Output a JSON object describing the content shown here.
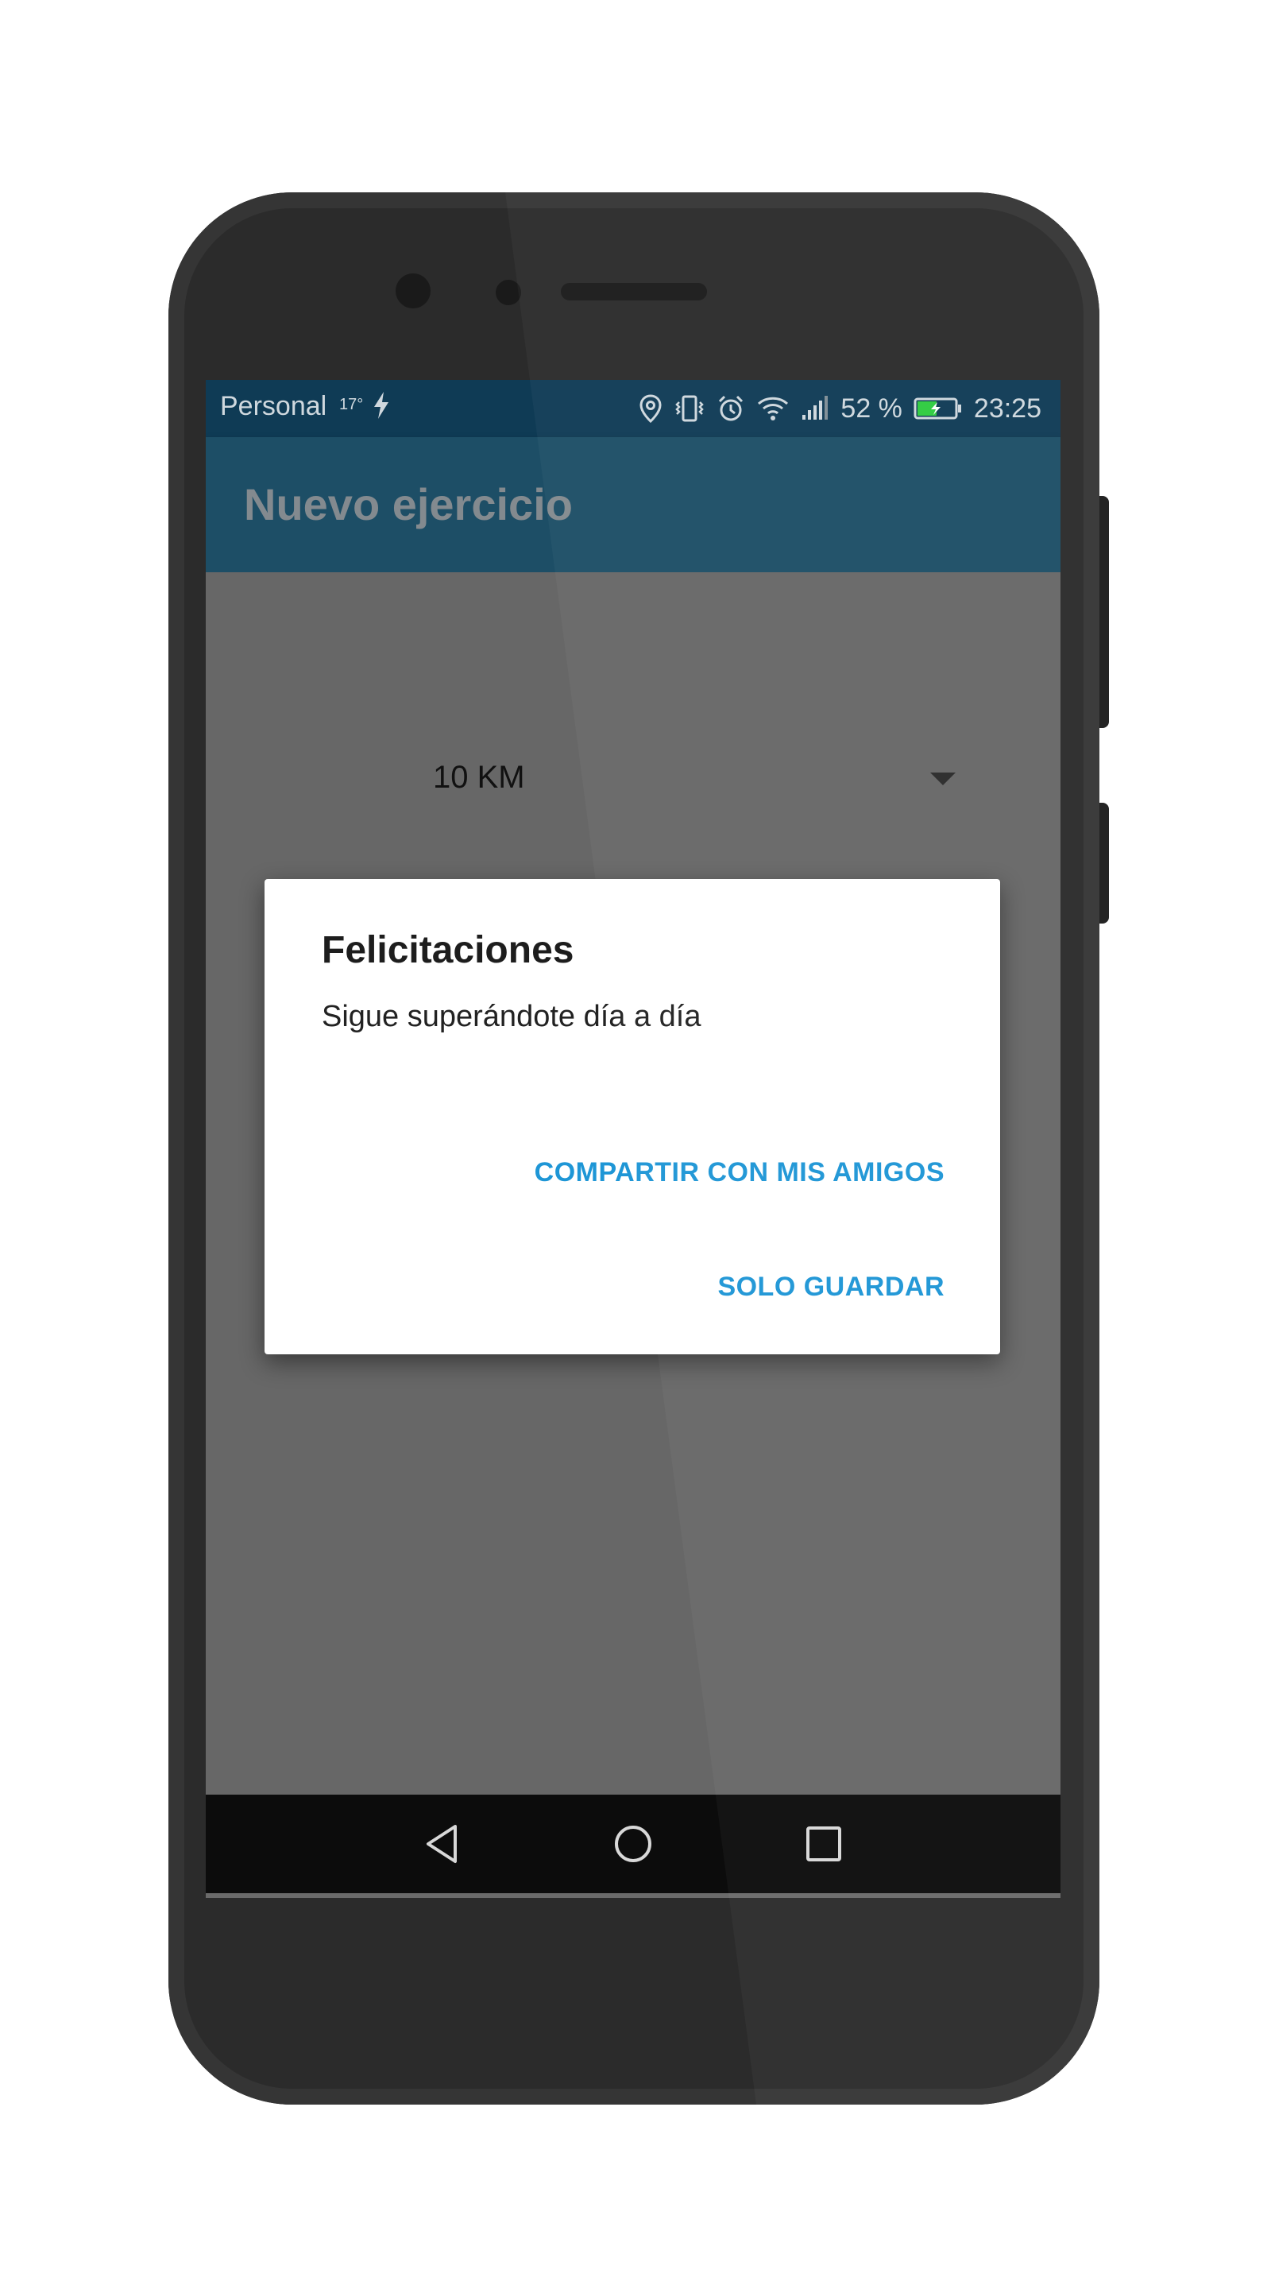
{
  "status_bar": {
    "carrier": "Personal",
    "temperature": "17°",
    "battery_percent": "52 %",
    "time": "23:25",
    "battery_level": 0.52,
    "icons": [
      "bolt-icon",
      "location-icon",
      "vibrate-icon",
      "alarm-icon",
      "wifi-icon",
      "signal-icon",
      "battery-icon"
    ]
  },
  "app_bar": {
    "title": "Nuevo ejercicio"
  },
  "exercise": {
    "icon": "running-person-icon",
    "distance_selected": "10 KM"
  },
  "dialog": {
    "title": "Felicitaciones",
    "message": "Sigue superándote día a día",
    "share_button": "COMPARTIR CON MIS AMIGOS",
    "save_button": "SOLO GUARDAR"
  },
  "nav_bar": {
    "icons": [
      "back-icon",
      "home-icon",
      "recents-icon"
    ]
  },
  "colors": {
    "accent": "#1e96d6",
    "app_bar": "#1d4e66",
    "status_bar": "#0f3b55",
    "scrim_content": "#676767",
    "phone_body": "#2b2b2b"
  }
}
